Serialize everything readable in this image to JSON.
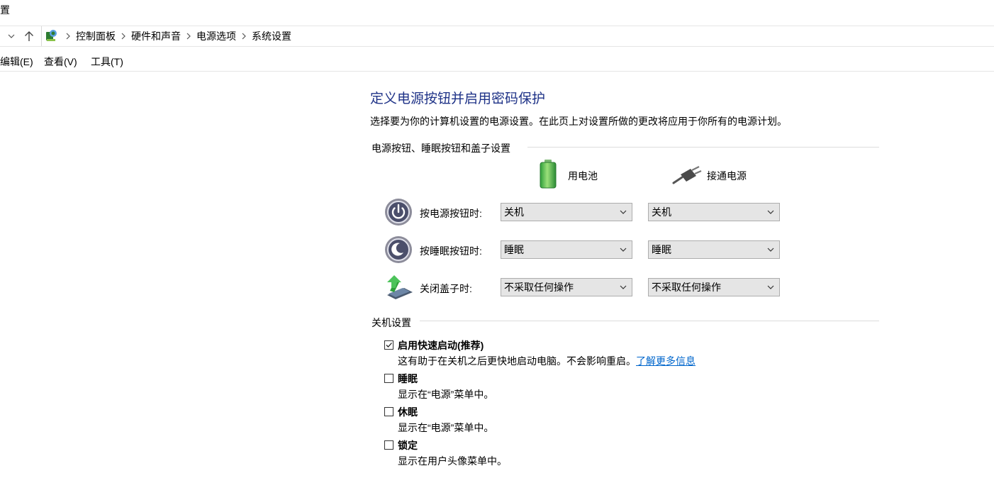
{
  "window": {
    "title_fragment": "置"
  },
  "breadcrumb": {
    "items": [
      "控制面板",
      "硬件和声音",
      "电源选项",
      "系统设置"
    ]
  },
  "menu": {
    "items": [
      "编辑(E)",
      "查看(V)",
      "工具(T)"
    ]
  },
  "main": {
    "heading": "定义电源按钮并启用密码保护",
    "description": "选择要为你的计算机设置的电源设置。在此页上对设置所做的更改将应用于你所有的电源计划。",
    "buttons_group": {
      "label": "电源按钮、睡眠按钮和盖子设置",
      "columns": {
        "battery": "用电池",
        "plugged": "接通电源"
      },
      "rows": [
        {
          "label": "按电源按钮时:",
          "battery": "关机",
          "plugged": "关机",
          "icon": "power-button-icon"
        },
        {
          "label": "按睡眠按钮时:",
          "battery": "睡眠",
          "plugged": "睡眠",
          "icon": "sleep-button-icon"
        },
        {
          "label": "关闭盖子时:",
          "battery": "不采取任何操作",
          "plugged": "不采取任何操作",
          "icon": "laptop-lid-icon"
        }
      ]
    },
    "shutdown_group": {
      "label": "关机设置",
      "options": [
        {
          "title": "启用快速启动(推荐)",
          "desc": "这有助于在关机之后更快地启动电脑。不会影响重启。",
          "link": "了解更多信息",
          "checked": true
        },
        {
          "title": "睡眠",
          "desc": "显示在“电源”菜单中。",
          "checked": false
        },
        {
          "title": "休眠",
          "desc": "显示在“电源”菜单中。",
          "checked": false
        },
        {
          "title": "锁定",
          "desc": "显示在用户头像菜单中。",
          "checked": false
        }
      ]
    }
  },
  "colors": {
    "heading": "#1e3287",
    "link": "#0066cc",
    "combo_bg": "#e5e5e5"
  }
}
